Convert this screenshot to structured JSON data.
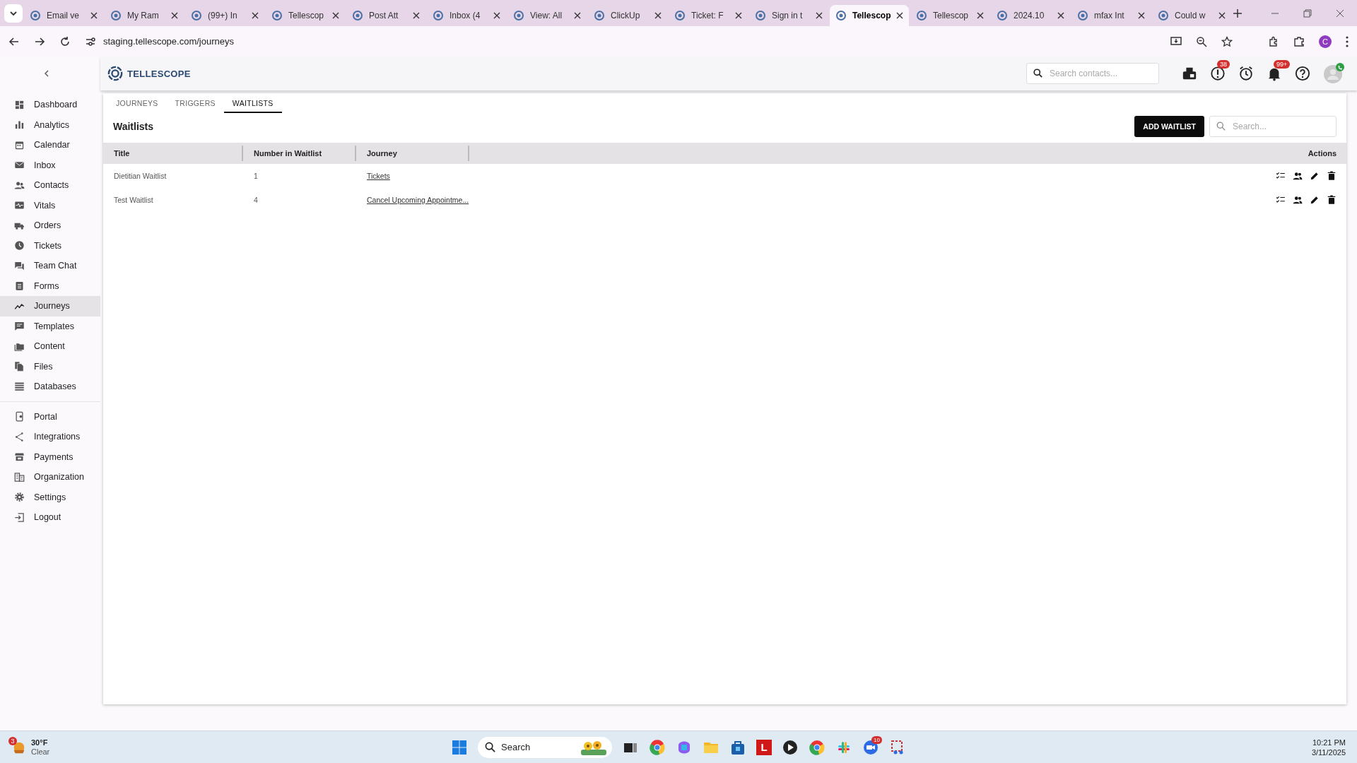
{
  "browser": {
    "tabs": [
      {
        "title": "Email ve",
        "selected": false
      },
      {
        "title": "My Ram",
        "selected": false
      },
      {
        "title": "(99+) In",
        "selected": false
      },
      {
        "title": "Tellescop",
        "selected": false
      },
      {
        "title": "Post Att",
        "selected": false
      },
      {
        "title": "Inbox (4",
        "selected": false
      },
      {
        "title": "View: All",
        "selected": false
      },
      {
        "title": "ClickUp",
        "selected": false
      },
      {
        "title": "Ticket: F",
        "selected": false
      },
      {
        "title": "Sign in t",
        "selected": false
      },
      {
        "title": "Tellescop",
        "selected": true
      },
      {
        "title": "Tellescop",
        "selected": false
      },
      {
        "title": "2024.10",
        "selected": false
      },
      {
        "title": "mfax Int",
        "selected": false
      },
      {
        "title": "Could w",
        "selected": false
      }
    ],
    "url": "staging.tellescope.com/journeys",
    "profile": "C"
  },
  "sidebar": {
    "groups": [
      [
        {
          "label": "Dashboard",
          "selected": false
        },
        {
          "label": "Analytics",
          "selected": false
        },
        {
          "label": "Calendar",
          "selected": false
        },
        {
          "label": "Inbox",
          "selected": false
        },
        {
          "label": "Contacts",
          "selected": false
        },
        {
          "label": "Vitals",
          "selected": false
        },
        {
          "label": "Orders",
          "selected": false
        },
        {
          "label": "Tickets",
          "selected": false
        },
        {
          "label": "Team Chat",
          "selected": false
        },
        {
          "label": "Forms",
          "selected": false
        },
        {
          "label": "Journeys",
          "selected": true
        },
        {
          "label": "Templates",
          "selected": false
        },
        {
          "label": "Content",
          "selected": false
        },
        {
          "label": "Files",
          "selected": false
        },
        {
          "label": "Databases",
          "selected": false
        }
      ],
      [
        {
          "label": "Portal",
          "selected": false
        },
        {
          "label": "Integrations",
          "selected": false
        },
        {
          "label": "Payments",
          "selected": false
        },
        {
          "label": "Organization",
          "selected": false
        },
        {
          "label": "Settings",
          "selected": false
        },
        {
          "label": "Logout",
          "selected": false
        }
      ]
    ]
  },
  "header": {
    "logo": "TELLESCOPE",
    "search": {
      "placeholder": "Search contacts..."
    },
    "icons": [
      {
        "kind": "fax"
      },
      {
        "kind": "alert",
        "badge": "38"
      },
      {
        "kind": "alarm"
      },
      {
        "kind": "bell",
        "badge": "99+"
      },
      {
        "kind": "help"
      },
      {
        "kind": "avatar"
      }
    ]
  },
  "tabs": [
    {
      "label": "JOURNEYS",
      "selected": false
    },
    {
      "label": "TRIGGERS",
      "selected": false
    },
    {
      "label": "WAITLISTS",
      "selected": true
    }
  ],
  "panel": {
    "title": "Waitlists",
    "add_button": "ADD WAITLIST",
    "search": {
      "placeholder": "Search..."
    }
  },
  "table": {
    "columns": [
      "Title",
      "Number in Waitlist",
      "Journey",
      "Actions"
    ],
    "rows": [
      {
        "title": "Dietitian Waitlist",
        "number": "1",
        "journey": "Tickets"
      },
      {
        "title": "Test Waitlist",
        "number": "4",
        "journey": "Cancel Upcoming Appointme..."
      }
    ]
  },
  "taskbar": {
    "weather": {
      "badge": "3",
      "temperature": "30°F",
      "condition": "Clear"
    },
    "search": "Search",
    "letter_app": "L",
    "zoom_badge": "10",
    "time": "10:21 PM",
    "date": "3/11/2025"
  }
}
